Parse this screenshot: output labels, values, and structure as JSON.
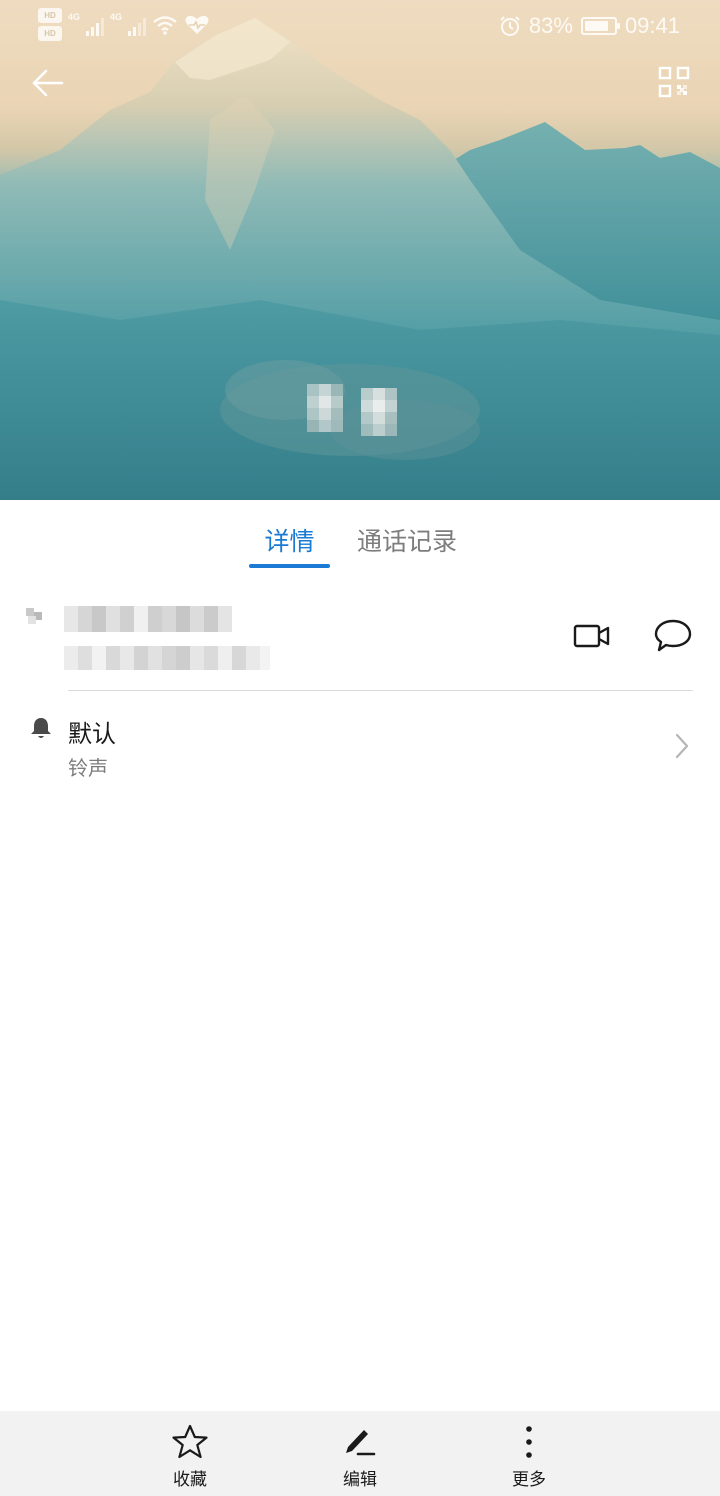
{
  "status_bar": {
    "hd_badges": [
      "HD",
      "HD"
    ],
    "network_labels": [
      "4G",
      "4G"
    ],
    "battery_percent": "83%",
    "battery_level": 0.83,
    "time": "09:41",
    "icons": [
      "signal-icon",
      "wifi-icon",
      "health-icon",
      "alarm-icon",
      "battery-icon"
    ]
  },
  "header": {
    "back_icon": "back-arrow-icon",
    "qr_icon": "qr-code-icon",
    "contact_name_redacted": true
  },
  "tabs": [
    {
      "label": "详情",
      "active": true
    },
    {
      "label": "通话记录",
      "active": false
    }
  ],
  "number_row": {
    "redacted": true,
    "actions": [
      "video-call-icon",
      "message-icon"
    ]
  },
  "ringtone": {
    "icon": "bell-icon",
    "value": "默认",
    "label": "铃声"
  },
  "bottom_bar": {
    "items": [
      {
        "label": "收藏",
        "icon": "star-icon"
      },
      {
        "label": "编辑",
        "icon": "edit-icon"
      },
      {
        "label": "更多",
        "icon": "more-vertical-icon"
      }
    ]
  },
  "colors": {
    "accent": "#1a7ad4",
    "text_primary": "#1a1a1a",
    "text_secondary": "#7d7d7d",
    "bottom_bar_bg": "#f2f2f2",
    "sky": "#efdcc0",
    "mountain": "#4d9ea6"
  }
}
